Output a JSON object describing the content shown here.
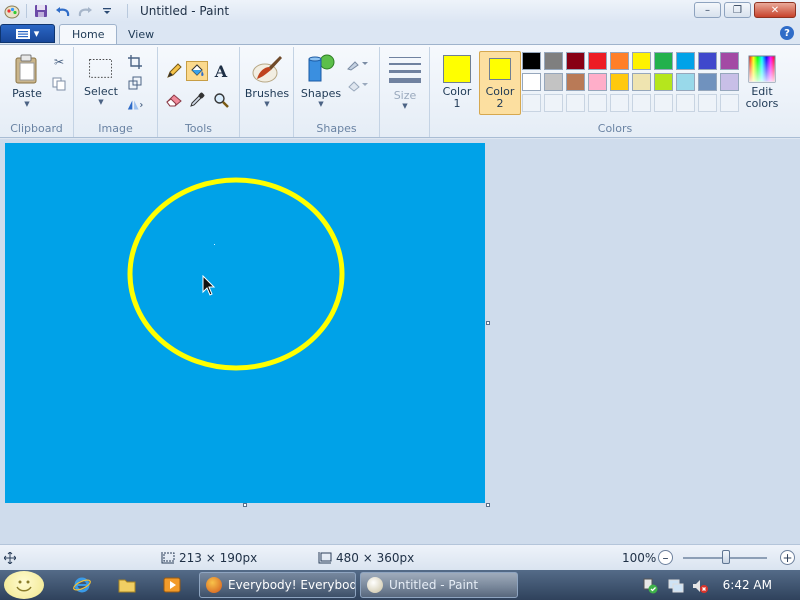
{
  "window": {
    "title": "Untitled - Paint",
    "controls": {
      "minimize": "–",
      "maximize": "❐",
      "close": "✕"
    }
  },
  "tabs": {
    "file": "▾",
    "home": "Home",
    "view": "View",
    "help": "?"
  },
  "ribbon": {
    "clipboard": {
      "label": "Clipboard",
      "paste": "Paste"
    },
    "image": {
      "label": "Image",
      "select": "Select"
    },
    "tools": {
      "label": "Tools"
    },
    "brushes": {
      "label": "Brushes"
    },
    "shapes": {
      "label": "Shapes",
      "button": "Shapes"
    },
    "size": {
      "label": "Size"
    },
    "colors": {
      "label": "Colors",
      "color1_line1": "Color",
      "color1_line2": "1",
      "color2_line1": "Color",
      "color2_line2": "2",
      "edit_line1": "Edit",
      "edit_line2": "colors",
      "color1_value": "#ffff00",
      "color2_value": "#ffff00",
      "palette_row1": [
        "#000000",
        "#7f7f7f",
        "#880015",
        "#ed1c24",
        "#ff7f27",
        "#fff200",
        "#22b14c",
        "#00a2e8",
        "#3f48cc",
        "#a349a4"
      ],
      "palette_row2": [
        "#ffffff",
        "#c3c3c3",
        "#b97a57",
        "#ffaec9",
        "#ffc90e",
        "#efe4b0",
        "#b5e61d",
        "#99d9ea",
        "#7092be",
        "#c8bfe7"
      ]
    }
  },
  "canvas": {
    "background": "#00a2e8",
    "ellipse_color": "#ffff00"
  },
  "status": {
    "cursor_pos": "213 × 190px",
    "canvas_size": "480 × 360px",
    "zoom": "100%",
    "zoom_level": 1.0
  },
  "taskbar": {
    "task1": "Everybody! Everybod...",
    "task2": "Untitled - Paint",
    "clock": "6:42 AM"
  }
}
